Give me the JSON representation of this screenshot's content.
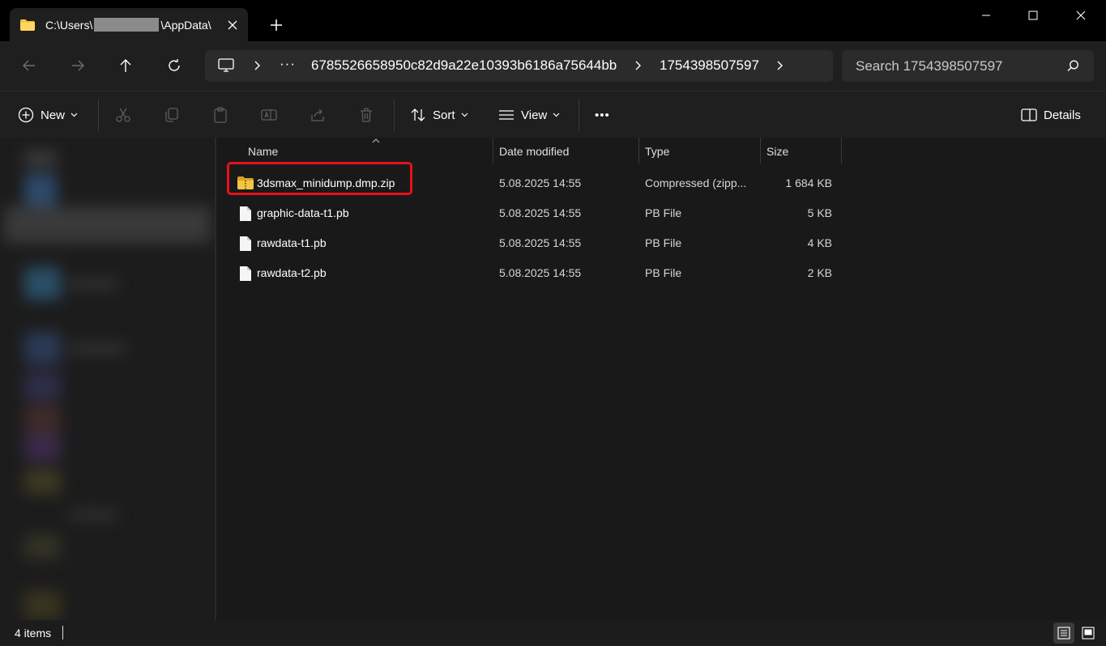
{
  "titlebar": {
    "tab_title_prefix": "C:\\Users\\",
    "tab_title_suffix": "\\AppData\\",
    "close_tab_label": "Close tab",
    "new_tab_label": "New tab",
    "minimize_label": "Minimize",
    "maximize_label": "Maximize",
    "close_label": "Close"
  },
  "address": {
    "more_label": "···",
    "crumbs": [
      "6785526658950c82d9a22e10393b6186a75644bb",
      "1754398507597"
    ]
  },
  "search": {
    "placeholder": "Search 1754398507597"
  },
  "commandbar": {
    "new_label": "New",
    "sort_label": "Sort",
    "view_label": "View",
    "more_label": "•••",
    "details_label": "Details"
  },
  "columns": {
    "name": "Name",
    "date": "Date modified",
    "type": "Type",
    "size": "Size"
  },
  "files": [
    {
      "name": "3dsmax_minidump.dmp.zip",
      "date": "5.08.2025 14:55",
      "type": "Compressed (zipp...",
      "size": "1 684 KB",
      "icon": "zip-folder-icon"
    },
    {
      "name": "graphic-data-t1.pb",
      "date": "5.08.2025 14:55",
      "type": "PB File",
      "size": "5 KB",
      "icon": "file-icon"
    },
    {
      "name": "rawdata-t1.pb",
      "date": "5.08.2025 14:55",
      "type": "PB File",
      "size": "4 KB",
      "icon": "file-icon"
    },
    {
      "name": "rawdata-t2.pb",
      "date": "5.08.2025 14:55",
      "type": "PB File",
      "size": "2 KB",
      "icon": "file-icon"
    }
  ],
  "status": {
    "item_count": "4 items"
  },
  "colors": {
    "highlight": "#e8101a",
    "folder": "#f4c542"
  }
}
